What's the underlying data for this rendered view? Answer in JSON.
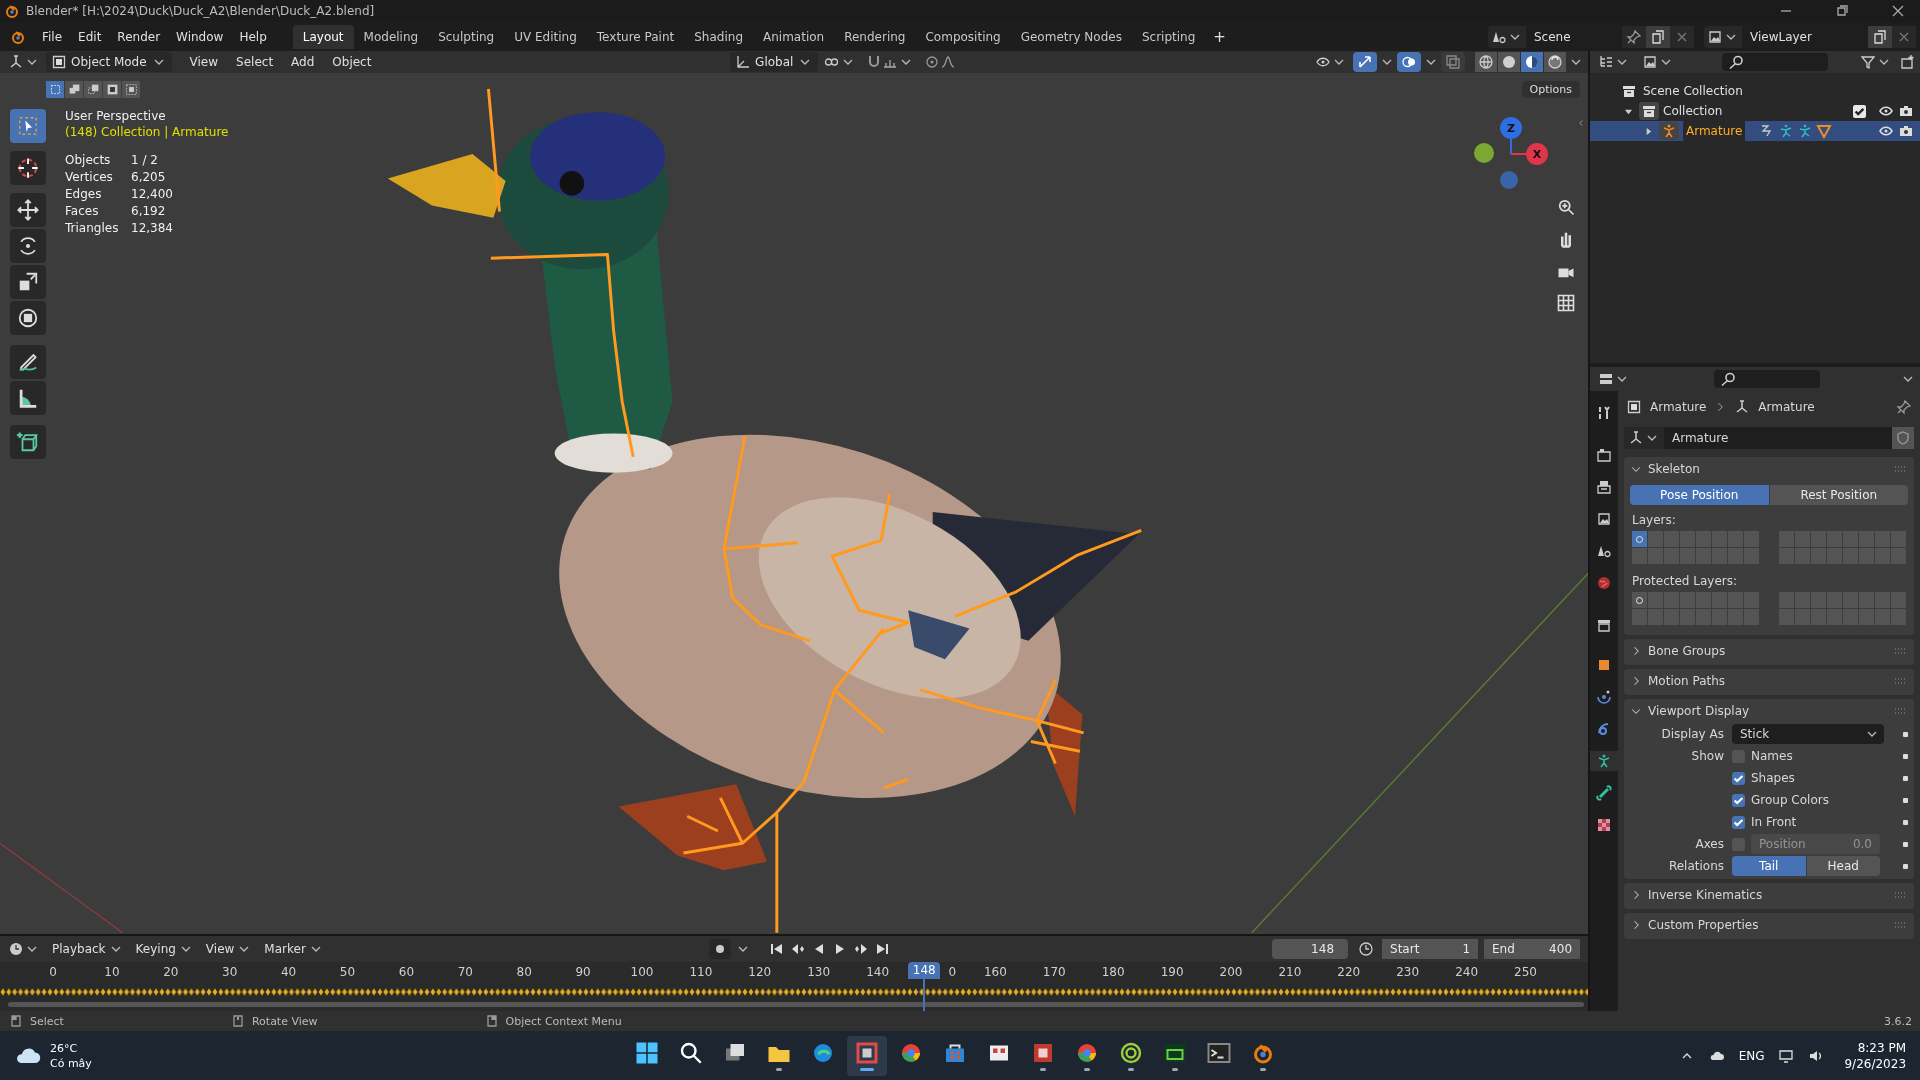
{
  "window": {
    "title": "Blender* [H:\\2024\\Duck\\Duck_A2\\Blender\\Duck_A2.blend]"
  },
  "menu": [
    "File",
    "Edit",
    "Render",
    "Window",
    "Help"
  ],
  "workspaces": [
    {
      "label": "Layout",
      "selected": true
    },
    {
      "label": "Modeling",
      "selected": false
    },
    {
      "label": "Sculpting",
      "selected": false
    },
    {
      "label": "UV Editing",
      "selected": false
    },
    {
      "label": "Texture Paint",
      "selected": false
    },
    {
      "label": "Shading",
      "selected": false
    },
    {
      "label": "Animation",
      "selected": false
    },
    {
      "label": "Rendering",
      "selected": false
    },
    {
      "label": "Compositing",
      "selected": false
    },
    {
      "label": "Geometry Nodes",
      "selected": false
    },
    {
      "label": "Scripting",
      "selected": false
    }
  ],
  "add_workspace": "+",
  "scene": "Scene",
  "view_layer": "ViewLayer",
  "viewport": {
    "mode": "Object Mode",
    "menus": [
      "View",
      "Select",
      "Add",
      "Object"
    ],
    "orientation": "Global",
    "gizmos": true,
    "overlays": true,
    "xray": false,
    "shading": [
      {
        "kind": "wireframe",
        "selected": false
      },
      {
        "kind": "solid",
        "selected": false
      },
      {
        "kind": "material",
        "selected": true
      },
      {
        "kind": "rendered",
        "selected": false
      }
    ],
    "options": "Options",
    "select_modes": [
      {
        "kind": "new",
        "selected": true
      },
      {
        "kind": "extend",
        "selected": false
      },
      {
        "kind": "subtract",
        "selected": false
      },
      {
        "kind": "invert",
        "selected": false
      },
      {
        "kind": "intersect",
        "selected": false
      }
    ],
    "tools": [
      {
        "kind": "select",
        "selected": true
      },
      {
        "kind": "cursor",
        "selected": false
      },
      {
        "kind": "move",
        "selected": false
      },
      {
        "kind": "rotate",
        "selected": false
      },
      {
        "kind": "scale",
        "selected": false
      },
      {
        "kind": "transform",
        "selected": false
      },
      {
        "kind": "annotate",
        "selected": false
      },
      {
        "kind": "measure",
        "selected": false
      },
      {
        "kind": "add_cube",
        "selected": false
      }
    ],
    "title": "User Perspective",
    "context": "(148) Collection | Armature",
    "stats": [
      {
        "label": "Objects",
        "value": "1 / 2"
      },
      {
        "label": "Vertices",
        "value": "6,205"
      },
      {
        "label": "Edges",
        "value": "12,400"
      },
      {
        "label": "Faces",
        "value": "6,192"
      },
      {
        "label": "Triangles",
        "value": "12,384"
      }
    ],
    "axes": [
      {
        "kind": "z",
        "label": "Z"
      },
      {
        "kind": "x",
        "label": "X"
      },
      {
        "kind": "y"
      },
      {
        "kind": "neg_z"
      }
    ]
  },
  "outliner": {
    "items": [
      {
        "label": "Scene Collection",
        "kind": "scene_collection",
        "selected": false,
        "children": [
          {
            "label": "Collection",
            "kind": "collection",
            "selected": false,
            "expanded": true,
            "enabled": true,
            "visible": true,
            "renderable": true,
            "children": [
              {
                "label": "Armature",
                "kind": "armature",
                "selected": true,
                "expanded": false,
                "visible": true,
                "renderable": true
              }
            ]
          }
        ]
      }
    ]
  },
  "properties": {
    "tabs": [
      {
        "kind": "tool",
        "selected": false
      },
      {
        "kind": "render",
        "selected": false
      },
      {
        "kind": "output",
        "selected": false
      },
      {
        "kind": "view_layer",
        "selected": false
      },
      {
        "kind": "scene",
        "selected": false
      },
      {
        "kind": "world",
        "selected": false
      },
      {
        "kind": "collection",
        "selected": false
      },
      {
        "kind": "object",
        "selected": false
      },
      {
        "kind": "physics",
        "selected": false
      },
      {
        "kind": "constraints",
        "selected": false
      },
      {
        "kind": "data",
        "selected": true
      },
      {
        "kind": "bone",
        "selected": false
      },
      {
        "kind": "texture",
        "selected": false
      }
    ],
    "breadcrumb": [
      "Armature",
      "Armature"
    ],
    "datablock": "Armature",
    "panels": [
      {
        "kind": "skeleton",
        "title": "Skeleton",
        "expanded": true,
        "positions": [
          {
            "label": "Pose Position",
            "selected": true
          },
          {
            "label": "Rest Position",
            "selected": false
          }
        ],
        "layers_label": "Layers:",
        "layers": [
          {
            "selected": true,
            "used": true
          },
          {
            "selected": false,
            "used": false
          },
          {
            "selected": false,
            "used": false
          },
          {
            "selected": false,
            "used": false
          },
          {
            "selected": false,
            "used": false
          },
          {
            "selected": false,
            "used": false
          },
          {
            "selected": false,
            "used": false
          },
          {
            "selected": false,
            "used": false
          },
          {
            "selected": false,
            "used": false
          },
          {
            "selected": false,
            "used": false
          },
          {
            "selected": false,
            "used": false
          },
          {
            "selected": false,
            "used": false
          },
          {
            "selected": false,
            "used": false
          },
          {
            "selected": false,
            "used": false
          },
          {
            "selected": false,
            "used": false
          },
          {
            "selected": false,
            "used": false
          },
          {
            "selected": false,
            "used": false
          },
          {
            "selected": false,
            "used": false
          },
          {
            "selected": false,
            "used": false
          },
          {
            "selected": false,
            "used": false
          },
          {
            "selected": false,
            "used": false
          },
          {
            "selected": false,
            "used": false
          },
          {
            "selected": false,
            "used": false
          },
          {
            "selected": false,
            "used": false
          },
          {
            "selected": false,
            "used": false
          },
          {
            "selected": false,
            "used": false
          },
          {
            "selected": false,
            "used": false
          },
          {
            "selected": false,
            "used": false
          },
          {
            "selected": false,
            "used": false
          },
          {
            "selected": false,
            "used": false
          },
          {
            "selected": false,
            "used": false
          },
          {
            "selected": false,
            "used": false
          }
        ],
        "protected_label": "Protected Layers:",
        "protected_layers": [
          {
            "selected": false,
            "used": true
          },
          {
            "selected": false,
            "used": false
          },
          {
            "selected": false,
            "used": false
          },
          {
            "selected": false,
            "used": false
          },
          {
            "selected": false,
            "used": false
          },
          {
            "selected": false,
            "used": false
          },
          {
            "selected": false,
            "used": false
          },
          {
            "selected": false,
            "used": false
          },
          {
            "selected": false,
            "used": false
          },
          {
            "selected": false,
            "used": false
          },
          {
            "selected": false,
            "used": false
          },
          {
            "selected": false,
            "used": false
          },
          {
            "selected": false,
            "used": false
          },
          {
            "selected": false,
            "used": false
          },
          {
            "selected": false,
            "used": false
          },
          {
            "selected": false,
            "used": false
          },
          {
            "selected": false,
            "used": false
          },
          {
            "selected": false,
            "used": false
          },
          {
            "selected": false,
            "used": false
          },
          {
            "selected": false,
            "used": false
          },
          {
            "selected": false,
            "used": false
          },
          {
            "selected": false,
            "used": false
          },
          {
            "selected": false,
            "used": false
          },
          {
            "selected": false,
            "used": false
          },
          {
            "selected": false,
            "used": false
          },
          {
            "selected": false,
            "used": false
          },
          {
            "selected": false,
            "used": false
          },
          {
            "selected": false,
            "used": false
          },
          {
            "selected": false,
            "used": false
          },
          {
            "selected": false,
            "used": false
          },
          {
            "selected": false,
            "used": false
          },
          {
            "selected": false,
            "used": false
          }
        ]
      },
      {
        "kind": "plain",
        "title": "Bone Groups",
        "expanded": false
      },
      {
        "kind": "plain",
        "title": "Motion Paths",
        "expanded": false
      },
      {
        "kind": "viewport_display",
        "title": "Viewport Display",
        "expanded": true,
        "display_as_label": "Display As",
        "display_as": "Stick",
        "show_label": "Show",
        "show": [
          {
            "label": "Names",
            "checked": false
          },
          {
            "label": "Shapes",
            "checked": true
          },
          {
            "label": "Group Colors",
            "checked": true
          },
          {
            "label": "In Front",
            "checked": true
          }
        ],
        "axes_label": "Axes",
        "axes_checked": false,
        "axes_position_label": "Position",
        "axes_position_value": "0.0",
        "relations_label": "Relations",
        "relations": [
          {
            "label": "Tail",
            "selected": true
          },
          {
            "label": "Head",
            "selected": false
          }
        ]
      },
      {
        "kind": "plain",
        "title": "Inverse Kinematics",
        "expanded": false
      },
      {
        "kind": "plain",
        "title": "Custom Properties",
        "expanded": false
      }
    ]
  },
  "timeline": {
    "menus": [
      "Playback",
      "Keying",
      "View",
      "Marker"
    ],
    "auto_key": false,
    "current_frame": "148",
    "start_label": "Start",
    "start": "1",
    "end_label": "End",
    "end": "400",
    "ticks": [
      {
        "label": "0"
      },
      {
        "label": "10"
      },
      {
        "label": "20"
      },
      {
        "label": "30"
      },
      {
        "label": "40"
      },
      {
        "label": "50"
      },
      {
        "label": "60"
      },
      {
        "label": "70"
      },
      {
        "label": "80"
      },
      {
        "label": "90"
      },
      {
        "label": "100"
      },
      {
        "label": "110"
      },
      {
        "label": "120"
      },
      {
        "label": "130"
      },
      {
        "label": "140"
      },
      {
        "label": "0",
        "partial": true
      },
      {
        "label": "160"
      },
      {
        "label": "170"
      },
      {
        "label": "180"
      },
      {
        "label": "190"
      },
      {
        "label": "200"
      },
      {
        "label": "210"
      },
      {
        "label": "220"
      },
      {
        "label": "230"
      },
      {
        "label": "240"
      },
      {
        "label": "250"
      }
    ],
    "playhead": {
      "label": "148",
      "level": 0.582
    }
  },
  "status_bar": {
    "hints": [
      {
        "kind": "left",
        "label": "Select"
      },
      {
        "kind": "middle",
        "label": "Rotate View"
      },
      {
        "kind": "right",
        "label": "Object Context Menu"
      }
    ],
    "version": "3.6.2"
  },
  "taskbar": {
    "temperature": "26°C",
    "condition": "Có mây",
    "apps": [
      {
        "kind": "start",
        "running": false,
        "selected": false
      },
      {
        "kind": "search",
        "running": false,
        "selected": false
      },
      {
        "kind": "task_view",
        "running": false,
        "selected": false
      },
      {
        "kind": "folder",
        "running": true,
        "selected": false
      },
      {
        "kind": "edge",
        "running": false,
        "selected": false
      },
      {
        "kind": "snip",
        "running": true,
        "selected": true
      },
      {
        "kind": "chrome",
        "running": false,
        "selected": false
      },
      {
        "kind": "store",
        "running": false,
        "selected": false
      },
      {
        "kind": "office",
        "running": false,
        "selected": false
      },
      {
        "kind": "red_app",
        "running": true,
        "selected": false
      },
      {
        "kind": "chrome",
        "running": true,
        "selected": false
      },
      {
        "kind": "target",
        "running": true,
        "selected": false
      },
      {
        "kind": "green_app",
        "running": true,
        "selected": false
      },
      {
        "kind": "terminal",
        "running": false,
        "selected": false
      },
      {
        "kind": "blender",
        "running": true,
        "selected": false
      }
    ],
    "language": "ENG",
    "time": "8:23 PM",
    "date": "9/26/2023"
  }
}
